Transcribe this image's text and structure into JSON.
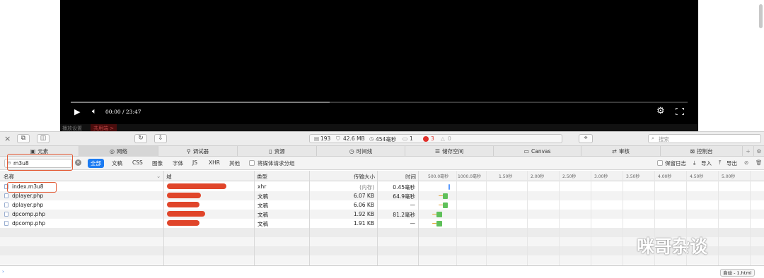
{
  "video": {
    "time": "00:00 / 23:47",
    "progress": 0.42,
    "subbar": [
      "播放设置",
      "共用端 >"
    ]
  },
  "toolbar": {
    "status": {
      "requests": "193",
      "size": "42.6 MB",
      "time": "454毫秒",
      "messages": "1",
      "errors": "3",
      "warnings": "0"
    },
    "search_placeholder": "搜索"
  },
  "tabs": [
    {
      "label": "元素",
      "icon": "elements-icon"
    },
    {
      "label": "网络",
      "icon": "network-icon"
    },
    {
      "label": "调试器",
      "icon": "debugger-icon"
    },
    {
      "label": "资源",
      "icon": "resources-icon"
    },
    {
      "label": "时间线",
      "icon": "timeline-icon"
    },
    {
      "label": "储存空间",
      "icon": "storage-icon"
    },
    {
      "label": "Canvas",
      "icon": "canvas-icon"
    },
    {
      "label": "审核",
      "icon": "audit-icon"
    },
    {
      "label": "控制台",
      "icon": "console-icon"
    }
  ],
  "filter": {
    "value": "m3u8",
    "types": [
      "全部",
      "文稿",
      "CSS",
      "图像",
      "字体",
      "JS",
      "XHR",
      "其他"
    ],
    "group_media": "将媒体请求分组",
    "preserve_log": "保留日志",
    "import": "导入",
    "export": "导出"
  },
  "columns": {
    "name": "名称",
    "domain": "域",
    "type": "类型",
    "size": "传输大小",
    "time": "时间"
  },
  "timeline_ticks": [
    "500.0毫秒",
    "1000.0毫秒",
    "1.50秒",
    "2.00秒",
    "2.50秒",
    "3.00秒",
    "3.50秒",
    "4.00秒",
    "4.50秒",
    "5.00秒"
  ],
  "rows": [
    {
      "name": "index.m3u8",
      "type": "xhr",
      "size": "(内存)",
      "time": "0.45毫秒"
    },
    {
      "name": "dplayer.php",
      "type": "文稿",
      "size": "6.07 KB",
      "time": "64.9毫秒"
    },
    {
      "name": "dplayer.php",
      "type": "文稿",
      "size": "6.06 KB",
      "time": "—"
    },
    {
      "name": "dpcomp.php",
      "type": "文稿",
      "size": "1.92 KB",
      "time": "81.2毫秒"
    },
    {
      "name": "dpcomp.php",
      "type": "文稿",
      "size": "1.91 KB",
      "time": "—"
    }
  ],
  "statusbar": {
    "context": "自动 - 1.html"
  },
  "watermark": "咪哥杂谈",
  "colors": {
    "accent": "#1d7cf2",
    "annotation": "#e35a35",
    "error": "#e0302a"
  }
}
